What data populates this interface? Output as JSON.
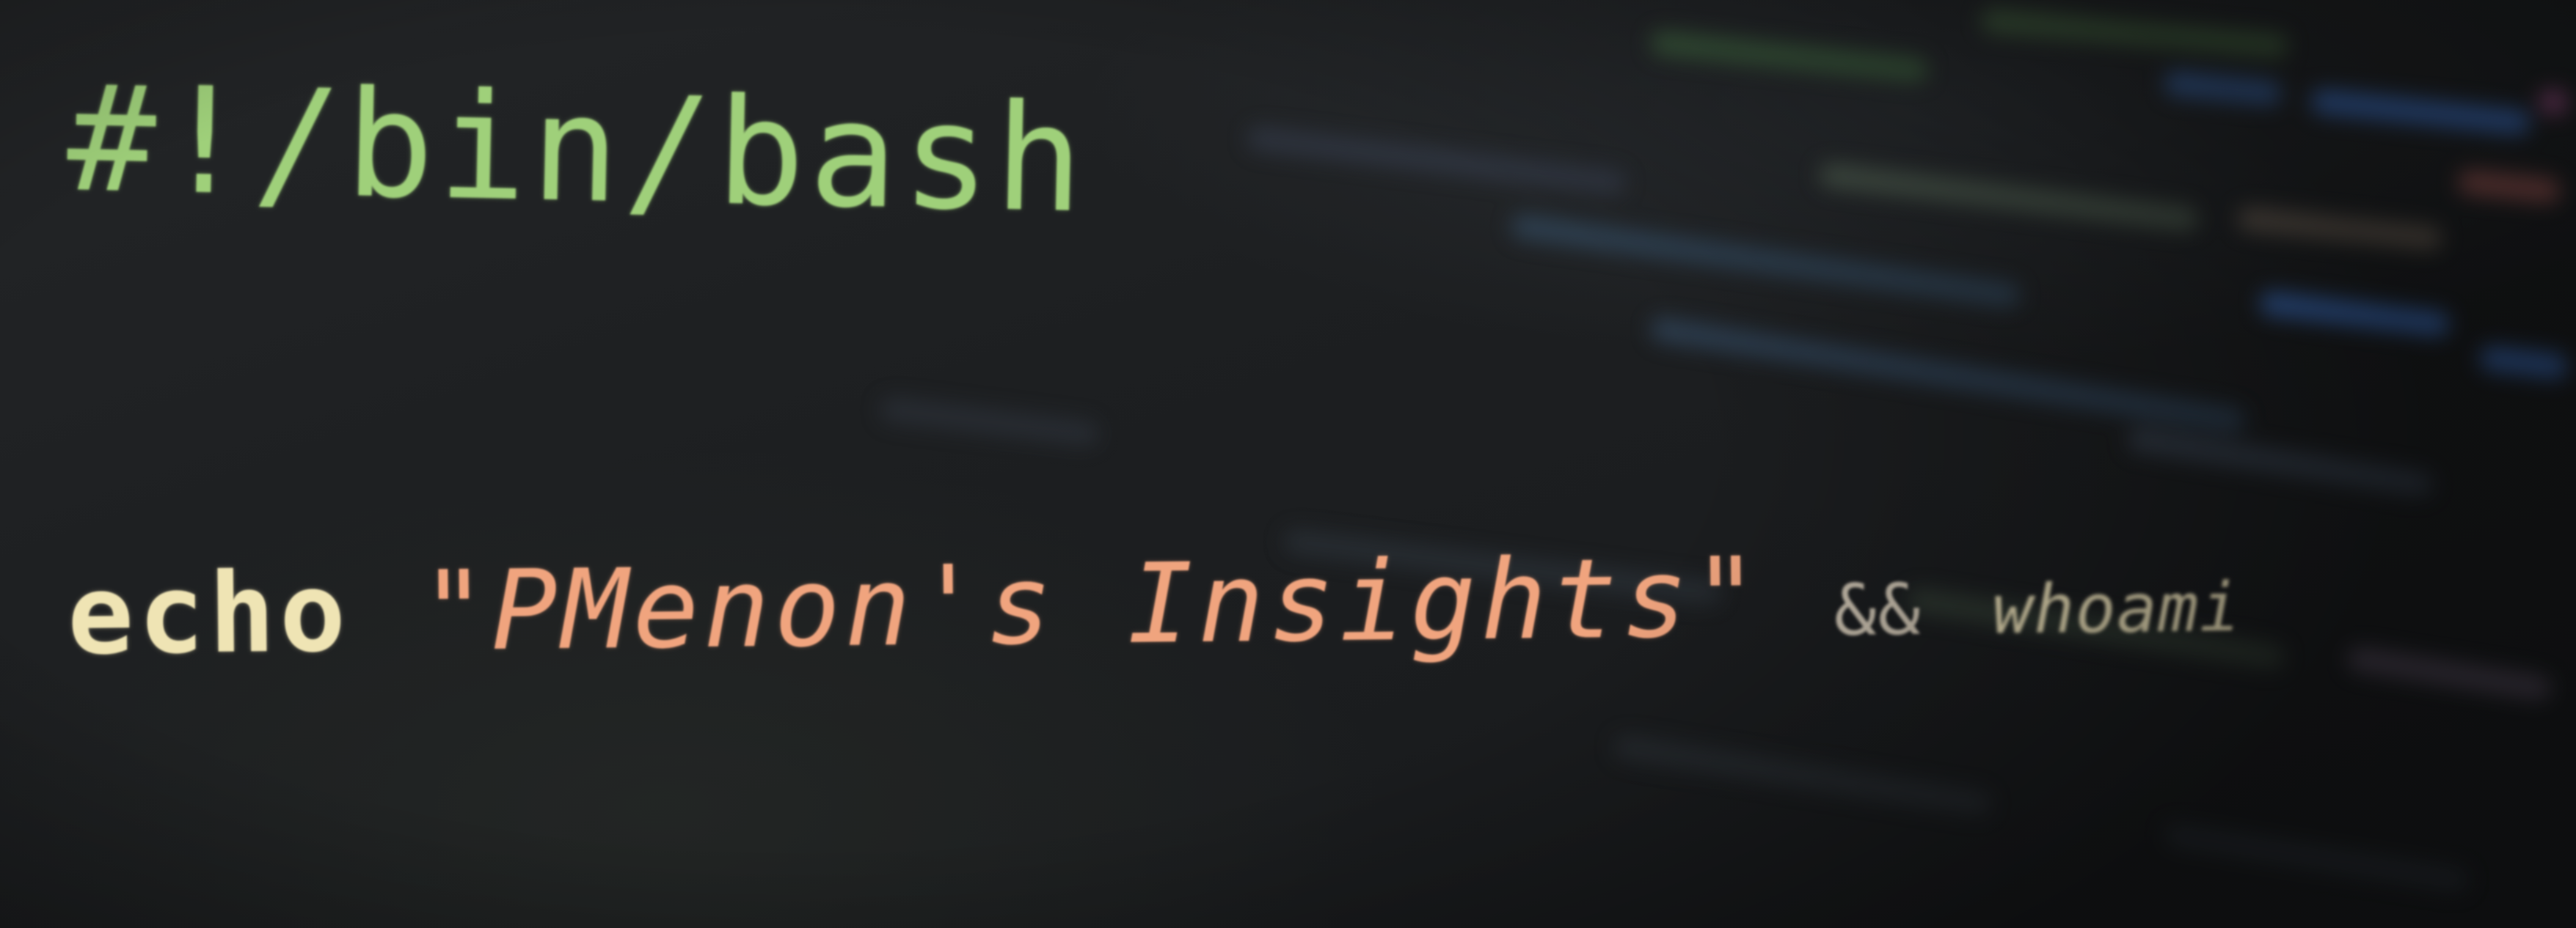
{
  "editor": {
    "line1": {
      "shebang": "#!/bin/bash"
    },
    "line2": {
      "keyword": "echo",
      "string": "\"PMenon's Insights\"",
      "operator": "&&",
      "command": "whoami"
    }
  },
  "colors": {
    "background": "#1b1d1f",
    "shebang": "#9fd07a",
    "keyword": "#efe4b4",
    "string": "#f0a47e",
    "operator": "#c9bfae",
    "command": "#e6dbb4"
  }
}
